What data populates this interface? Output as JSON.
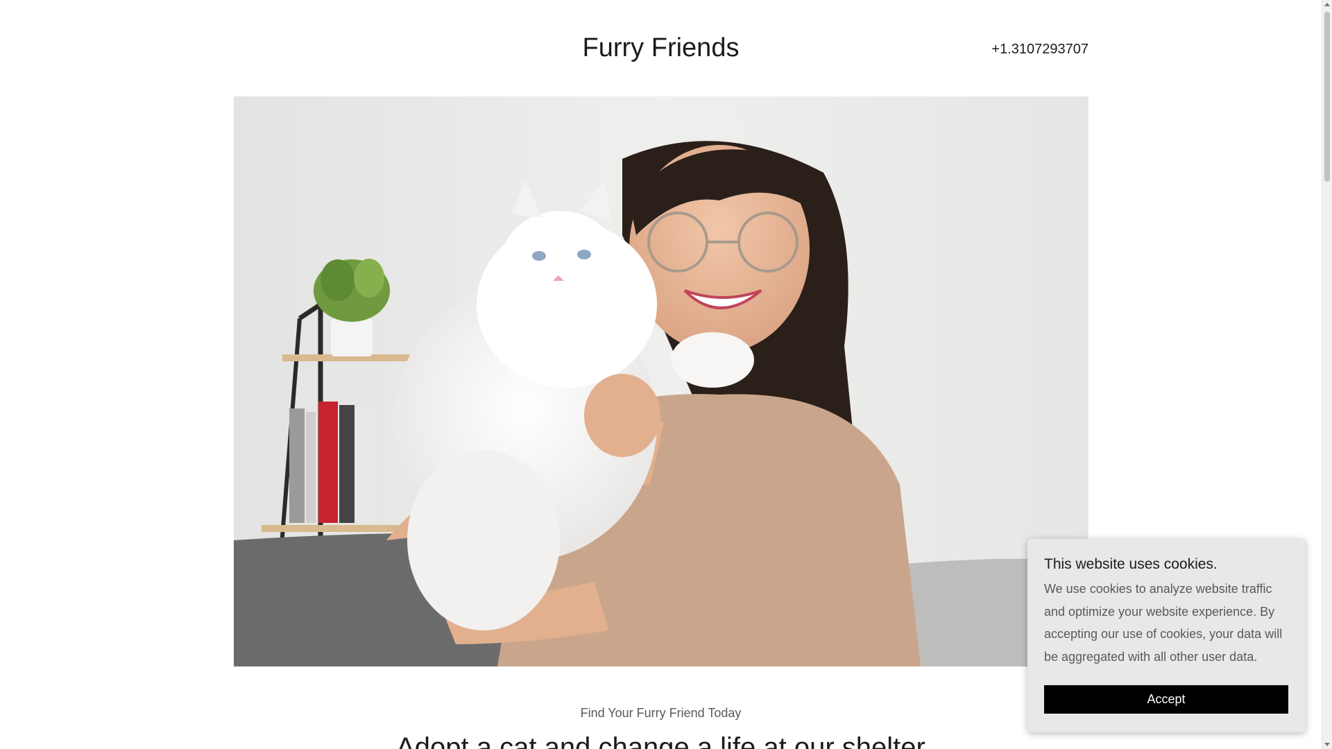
{
  "header": {
    "site_title": "Furry Friends",
    "phone": "+1.3107293707"
  },
  "hero": {
    "image_subject": "woman-hugging-white-cat-photo"
  },
  "intro": {
    "tagline": "Find Your Furry Friend Today",
    "headline": "Adopt a cat and change a life at our shelter"
  },
  "cookie_banner": {
    "title": "This website uses cookies.",
    "body": "We use cookies to analyze website traffic and optimize your website experience. By accepting our use of cookies, your data will be aggregated with all other user data.",
    "accept_label": "Accept"
  },
  "colors": {
    "text": "#1b1b1b",
    "muted_text": "#595959",
    "accept_button": "#000000",
    "cookie_bg": "#e8e8e8"
  }
}
